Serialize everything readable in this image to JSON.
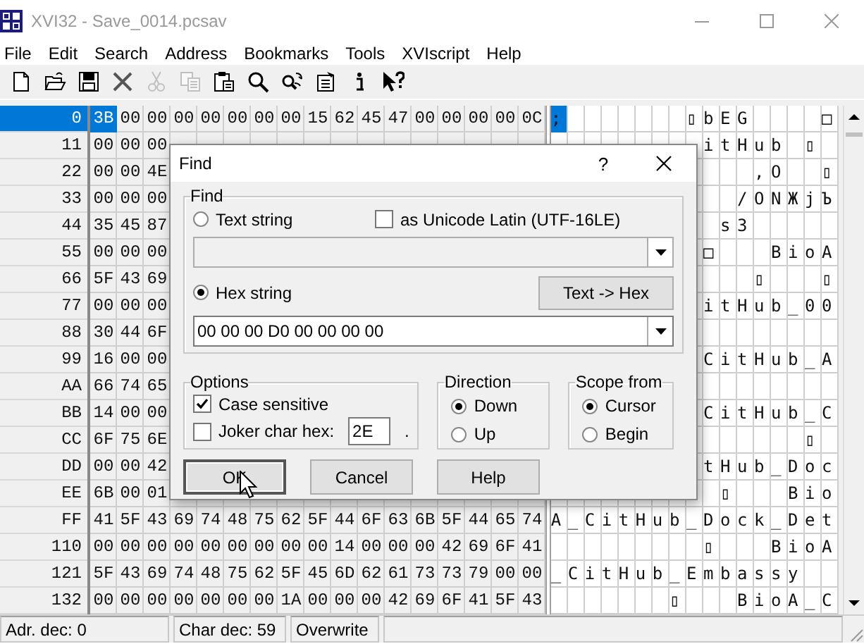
{
  "window": {
    "title": "XVI32 - Save_0014.pcsav"
  },
  "menu": [
    "File",
    "Edit",
    "Search",
    "Address",
    "Bookmarks",
    "Tools",
    "XVIscript",
    "Help"
  ],
  "toolbar": [
    {
      "kind": "new",
      "disabled": false
    },
    {
      "kind": "open",
      "disabled": false
    },
    {
      "kind": "save",
      "disabled": false
    },
    {
      "kind": "delete",
      "disabled": false
    },
    {
      "kind": "cut",
      "disabled": true
    },
    {
      "kind": "copy",
      "disabled": true
    },
    {
      "kind": "paste",
      "disabled": false
    },
    {
      "kind": "find",
      "disabled": false
    },
    {
      "kind": "replace",
      "disabled": false
    },
    {
      "kind": "properties",
      "disabled": false
    },
    {
      "kind": "info",
      "disabled": false
    },
    {
      "kind": "whatsthis",
      "disabled": false
    }
  ],
  "rows": [
    {
      "address": "0",
      "selected": true,
      "hex": [
        {
          "text": "3B",
          "selected": true
        },
        "00",
        "00",
        "00",
        "00",
        "00",
        "00",
        "00",
        "15",
        "62",
        "45",
        "47",
        "00",
        "00",
        "00",
        "00",
        "0C"
      ],
      "chars": ";       ▯bEG    □"
    },
    {
      "address": "11",
      "selected": false,
      "hex": [
        "00",
        "00",
        "00"
      ],
      "chars": "itHub ▯ "
    },
    {
      "address": "22",
      "selected": false,
      "hex": [
        "00",
        "00",
        "4E"
      ],
      "chars": "   ,O  ▯"
    },
    {
      "address": "33",
      "selected": false,
      "hex": [
        "00",
        "00",
        "00"
      ],
      "chars": "  /ONЖjЪ"
    },
    {
      "address": "44",
      "selected": false,
      "hex": [
        "35",
        "45",
        "87"
      ],
      "chars": " s3     "
    },
    {
      "address": "55",
      "selected": false,
      "hex": [
        "00",
        "00",
        "00"
      ],
      "chars": "□   BioA"
    },
    {
      "address": "66",
      "selected": false,
      "hex": [
        "5F",
        "43",
        "69"
      ],
      "chars": "   ▯   ▯"
    },
    {
      "address": "77",
      "selected": false,
      "hex": [
        "00",
        "00",
        "00"
      ],
      "chars": "itHub_00"
    },
    {
      "address": "88",
      "selected": false,
      "hex": [
        "30",
        "44",
        "6F"
      ]
    },
    {
      "address": "99",
      "selected": false,
      "hex": [
        "16",
        "00",
        "00"
      ],
      "chars": "CitHub_A"
    },
    {
      "address": "AA",
      "selected": false,
      "hex": [
        "66",
        "74",
        "65"
      ]
    },
    {
      "address": "BB",
      "selected": false,
      "hex": [
        "14",
        "00",
        "00"
      ],
      "chars": "CitHub_C"
    },
    {
      "address": "CC",
      "selected": false,
      "hex": [
        "6F",
        "75",
        "6E"
      ],
      "chars": "      ▯ "
    },
    {
      "address": "DD",
      "selected": false,
      "hex": [
        "00",
        "00",
        "42"
      ],
      "chars": "tHub_Doc"
    },
    {
      "address": "EE",
      "selected": false,
      "hex": [
        "6B",
        "00",
        "01"
      ],
      "chars": " ▯   Bio"
    },
    {
      "address": "FF",
      "selected": false,
      "hex": [
        "41",
        "5F",
        "43",
        "69",
        "74",
        "48",
        "75",
        "62",
        "5F",
        "44",
        "6F",
        "63",
        "6B",
        "5F",
        "44",
        "65",
        "74"
      ],
      "chars": "A_CitHub_Dock_Det"
    },
    {
      "address": "110",
      "selected": false,
      "hex": [
        "00",
        "00",
        "00",
        "00",
        "00",
        "00",
        "00",
        "00",
        "00",
        "14",
        "00",
        "00",
        "00",
        "42",
        "69",
        "6F",
        "41"
      ],
      "chars": "         ▯   BioA"
    },
    {
      "address": "121",
      "selected": false,
      "hex": [
        "5F",
        "43",
        "69",
        "74",
        "48",
        "75",
        "62",
        "5F",
        "45",
        "6D",
        "62",
        "61",
        "73",
        "73",
        "79",
        "00",
        "00"
      ],
      "chars": "_CitHub_Embassy  "
    },
    {
      "address": "132",
      "selected": false,
      "hex": [
        "00",
        "00",
        "00",
        "00",
        "00",
        "00",
        "00",
        "1A",
        "00",
        "00",
        "00",
        "42",
        "69",
        "6F",
        "41",
        "5F",
        "43"
      ],
      "chars": "       ▯   BioA_C"
    }
  ],
  "status_bar": [
    "Adr. dec: 0",
    "Char dec: 59",
    "Overwrite"
  ],
  "find_dialog": {
    "title": "Find",
    "help_button": "?",
    "find": {
      "legend": "Find",
      "text_string": {
        "label": "Text string",
        "selected": false
      },
      "unicode": {
        "label": "as Unicode Latin (UTF-16LE)",
        "checked": false
      },
      "text_input": {
        "disabled": true
      },
      "hex_string": {
        "label": "Hex string",
        "selected": true
      },
      "convert_button": "Text -> Hex",
      "hex_input": {
        "value": "00 00 00 D0 00 00 00 00"
      }
    },
    "options": {
      "legend": "Options",
      "case_sensitive": {
        "label": "Case sensitive",
        "checked": true
      },
      "joker": {
        "label": "Joker char hex:",
        "checked": false,
        "value": "2E",
        "suffix": "."
      }
    },
    "direction": {
      "legend": "Direction",
      "choices": [
        {
          "label": "Down",
          "selected": true
        },
        {
          "label": "Up",
          "selected": false
        }
      ]
    },
    "scope": {
      "legend": "Scope from",
      "choices": [
        {
          "label": "Cursor",
          "selected": true
        },
        {
          "label": "Begin",
          "selected": false
        }
      ]
    },
    "buttons": [
      {
        "label": "OK",
        "default": true
      },
      {
        "label": "Cancel",
        "default": false
      },
      {
        "label": "Help",
        "default": false
      }
    ]
  }
}
